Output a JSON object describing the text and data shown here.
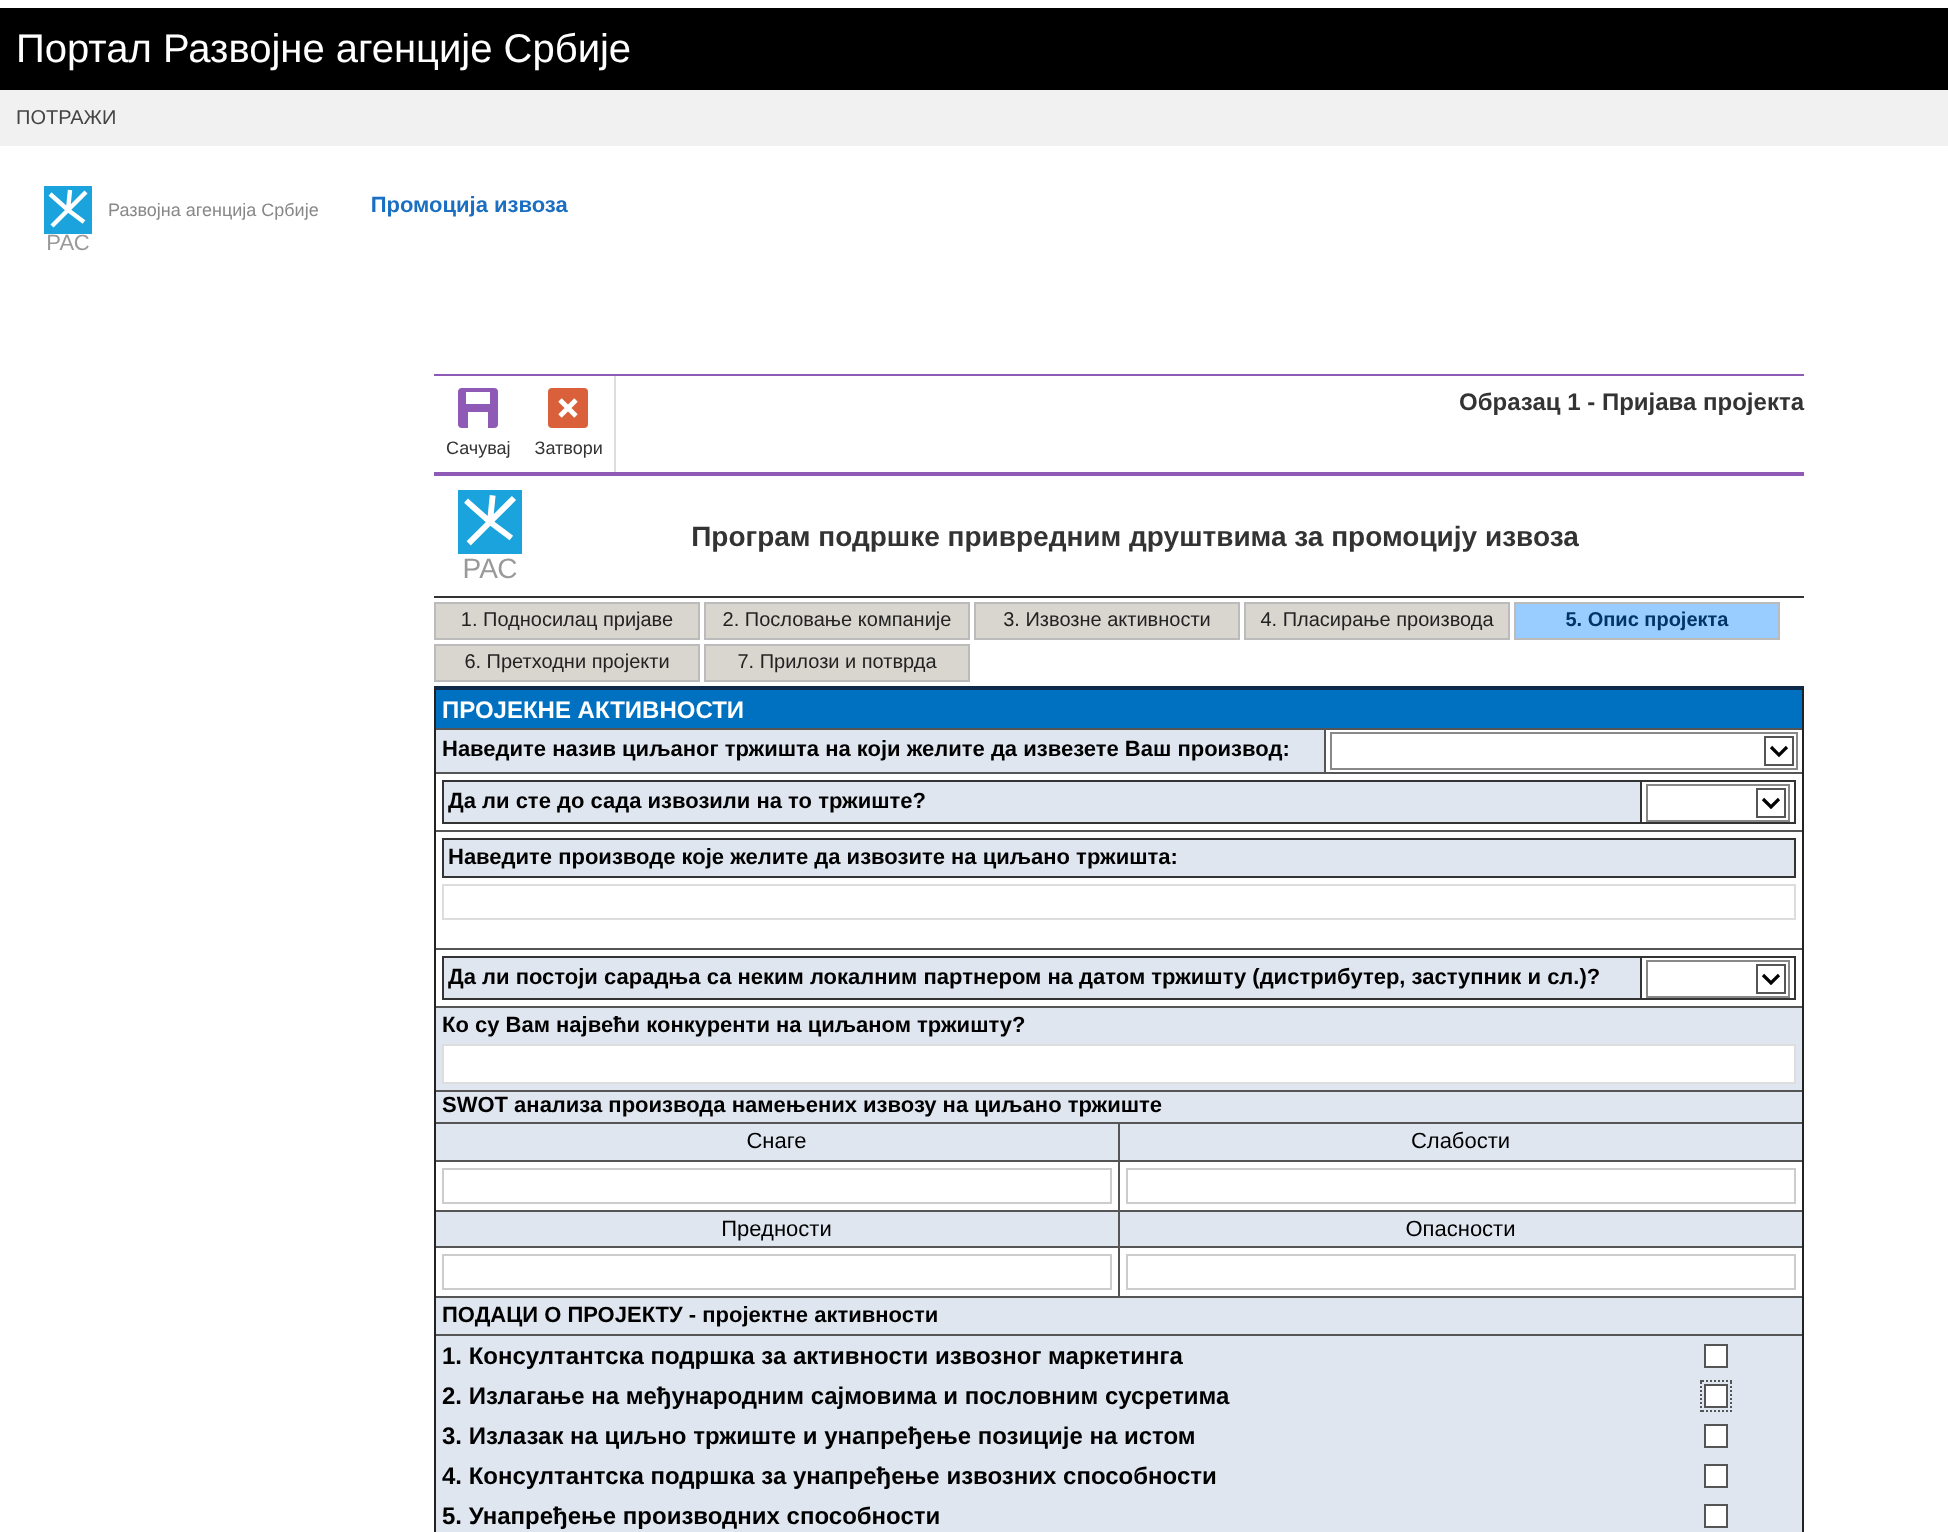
{
  "header": {
    "title": "Портал Развојне агенције Србије"
  },
  "nav": {
    "search_link": "ПОТРАЖИ"
  },
  "brand": {
    "logo_text": "РАС",
    "agency_name": "Развојна агенција Србије",
    "section_link": "Промоција извоза"
  },
  "form": {
    "toolbar": [
      {
        "label": "Сачувај",
        "kind": "save"
      },
      {
        "label": "Затвори",
        "kind": "close"
      }
    ],
    "form_title": "Образац 1 - Пријава пројекта",
    "logo_text": "РАС",
    "program_title": "Програм подршке привредним друштвима за промоцију извоза",
    "tabs": [
      {
        "label": "1. Подносилац пријаве",
        "selected": false
      },
      {
        "label": "2. Пословање компаније",
        "selected": false
      },
      {
        "label": "3. Извозне активности",
        "selected": false
      },
      {
        "label": "4. Пласирање производа",
        "selected": false
      },
      {
        "label": "5. Опис пројекта",
        "selected": true
      },
      {
        "label": "6. Претходни пројекти",
        "selected": false
      },
      {
        "label": "7. Прилози и потврда",
        "selected": false
      }
    ],
    "section_title": "ПРОЈЕКНЕ АКТИВНОСТИ",
    "questions": [
      {
        "label": "Наведите назив циљаног тржишта на који желите да извезете Ваш производ:",
        "kind": "select_wide"
      },
      {
        "label": "Да ли сте до сада извозили на то тржиште?",
        "kind": "select"
      },
      {
        "label": "Наведите производе које желите да извозите на циљано тржишта:",
        "kind": "text"
      },
      {
        "label": "Да ли постоји сарадња са неким локалним партнером на датом тржишту (дистрибутер, заступник и сл.)?",
        "kind": "select"
      },
      {
        "label": "Ко су Вам највећи конкуренти на циљаном тржишту?",
        "kind": "plain_text"
      }
    ],
    "swot": {
      "title": "SWOT анализа производа намењених извозу на циљано тржиште",
      "labels": [
        "Снаге",
        "Слабости",
        "Предности",
        "Опасности"
      ]
    },
    "activities": {
      "title": "ПОДАЦИ О ПРОЈЕКТУ - пројектне активности",
      "items": [
        {
          "label": "1. Консултантска подршка за активности извозног маркетинга",
          "checked": false,
          "focused": false
        },
        {
          "label": "2. Излагање на међународним сајмовима и пословним сусретима",
          "checked": false,
          "focused": true
        },
        {
          "label": "3. Излазак на циљно тржиште и унапређење позиције на истом",
          "checked": false,
          "focused": false
        },
        {
          "label": "4. Консултантска подршка за унапређење извозних способности",
          "checked": false,
          "focused": false
        },
        {
          "label": "5. Унапређење производних способности",
          "checked": false,
          "focused": false
        }
      ]
    }
  }
}
